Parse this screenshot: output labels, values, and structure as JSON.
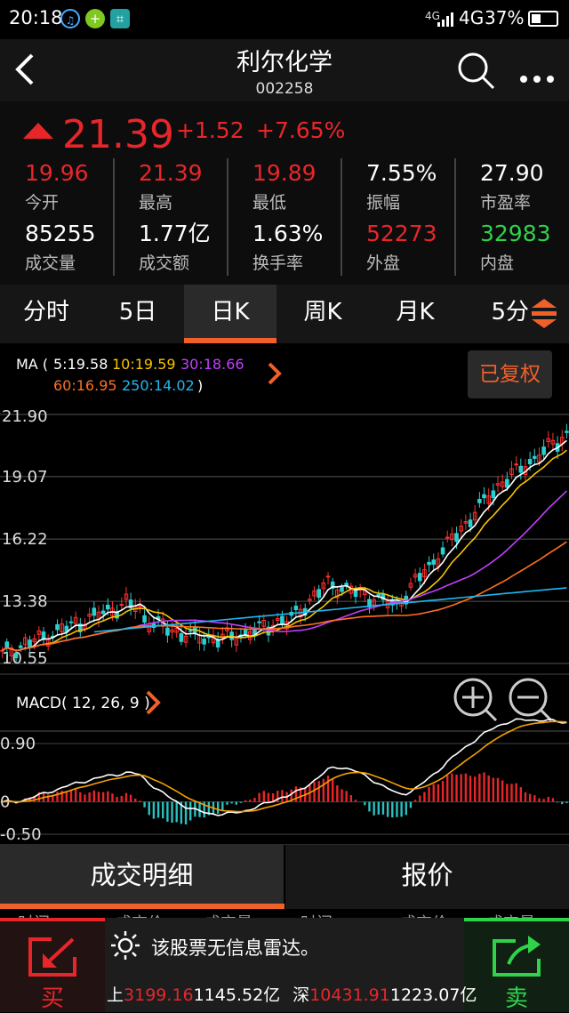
{
  "status": {
    "time": "20:18",
    "network": "4G",
    "signal": "4G",
    "battery": "37%",
    "battery_level": 0.37
  },
  "header": {
    "title": "利尔化学",
    "code": "002258"
  },
  "quote": {
    "price": "21.39",
    "change": "+1.52",
    "change_pct": "+7.65%",
    "stats": [
      {
        "v": "19.96",
        "l": "今开",
        "color": "up"
      },
      {
        "v": "21.39",
        "l": "最高",
        "color": "up"
      },
      {
        "v": "19.89",
        "l": "最低",
        "color": "up"
      },
      {
        "v": "7.55%",
        "l": "振幅",
        "color": "neutral"
      },
      {
        "v": "27.90",
        "l": "市盈率",
        "color": "neutral"
      },
      {
        "v": "85255",
        "l": "成交量",
        "color": "neutral"
      },
      {
        "v": "1.77亿",
        "l": "成交额",
        "color": "neutral"
      },
      {
        "v": "1.63%",
        "l": "换手率",
        "color": "neutral"
      },
      {
        "v": "52273",
        "l": "外盘",
        "color": "up"
      },
      {
        "v": "32983",
        "l": "内盘",
        "color": "down"
      }
    ]
  },
  "tabs": [
    "分时",
    "5日",
    "日K",
    "周K",
    "月K",
    "5分"
  ],
  "active_tab": "日K",
  "ma": {
    "prefix": "MA (",
    "m5": "5:19.58",
    "m10": "10:19.59",
    "m30": "30:18.66",
    "m60": "60:16.95",
    "m250": "250:14.02",
    "suffix": ")",
    "fuquan": "已复权"
  },
  "kline": {
    "ticks": [
      "21.90",
      "19.07",
      "16.22",
      "13.38",
      "10.55"
    ]
  },
  "macd": {
    "label": "MACD( 12, 26, 9 )",
    "ticks": [
      "0.90",
      "0",
      "-0.50"
    ]
  },
  "detail_tabs": [
    "成交明细",
    "报价"
  ],
  "detail_header_partial": [
    "时间",
    "成交价",
    "成交量",
    "时间",
    "成交价",
    "成交量"
  ],
  "radar_msg": "该股票无信息雷达。",
  "index": {
    "sh_label": "上",
    "sh_val": "3199.16",
    "sh_amt": "1145.52亿",
    "sz_label": "深",
    "sz_val": "10431.91",
    "sz_amt": "1223.07亿"
  },
  "buy": "买",
  "sell": "卖",
  "colors": {
    "up": "#e8262a",
    "down": "#2fd24a",
    "accent": "#f0602a",
    "ma5": "#ffffff",
    "ma10": "#f5c400",
    "ma30": "#c040ff",
    "ma60": "#ff7020",
    "ma250": "#20b8f0",
    "dif": "#ffffff",
    "dea": "#f5a000",
    "hist_pos": "#e8262a",
    "hist_neg": "#2ac0c0"
  }
}
